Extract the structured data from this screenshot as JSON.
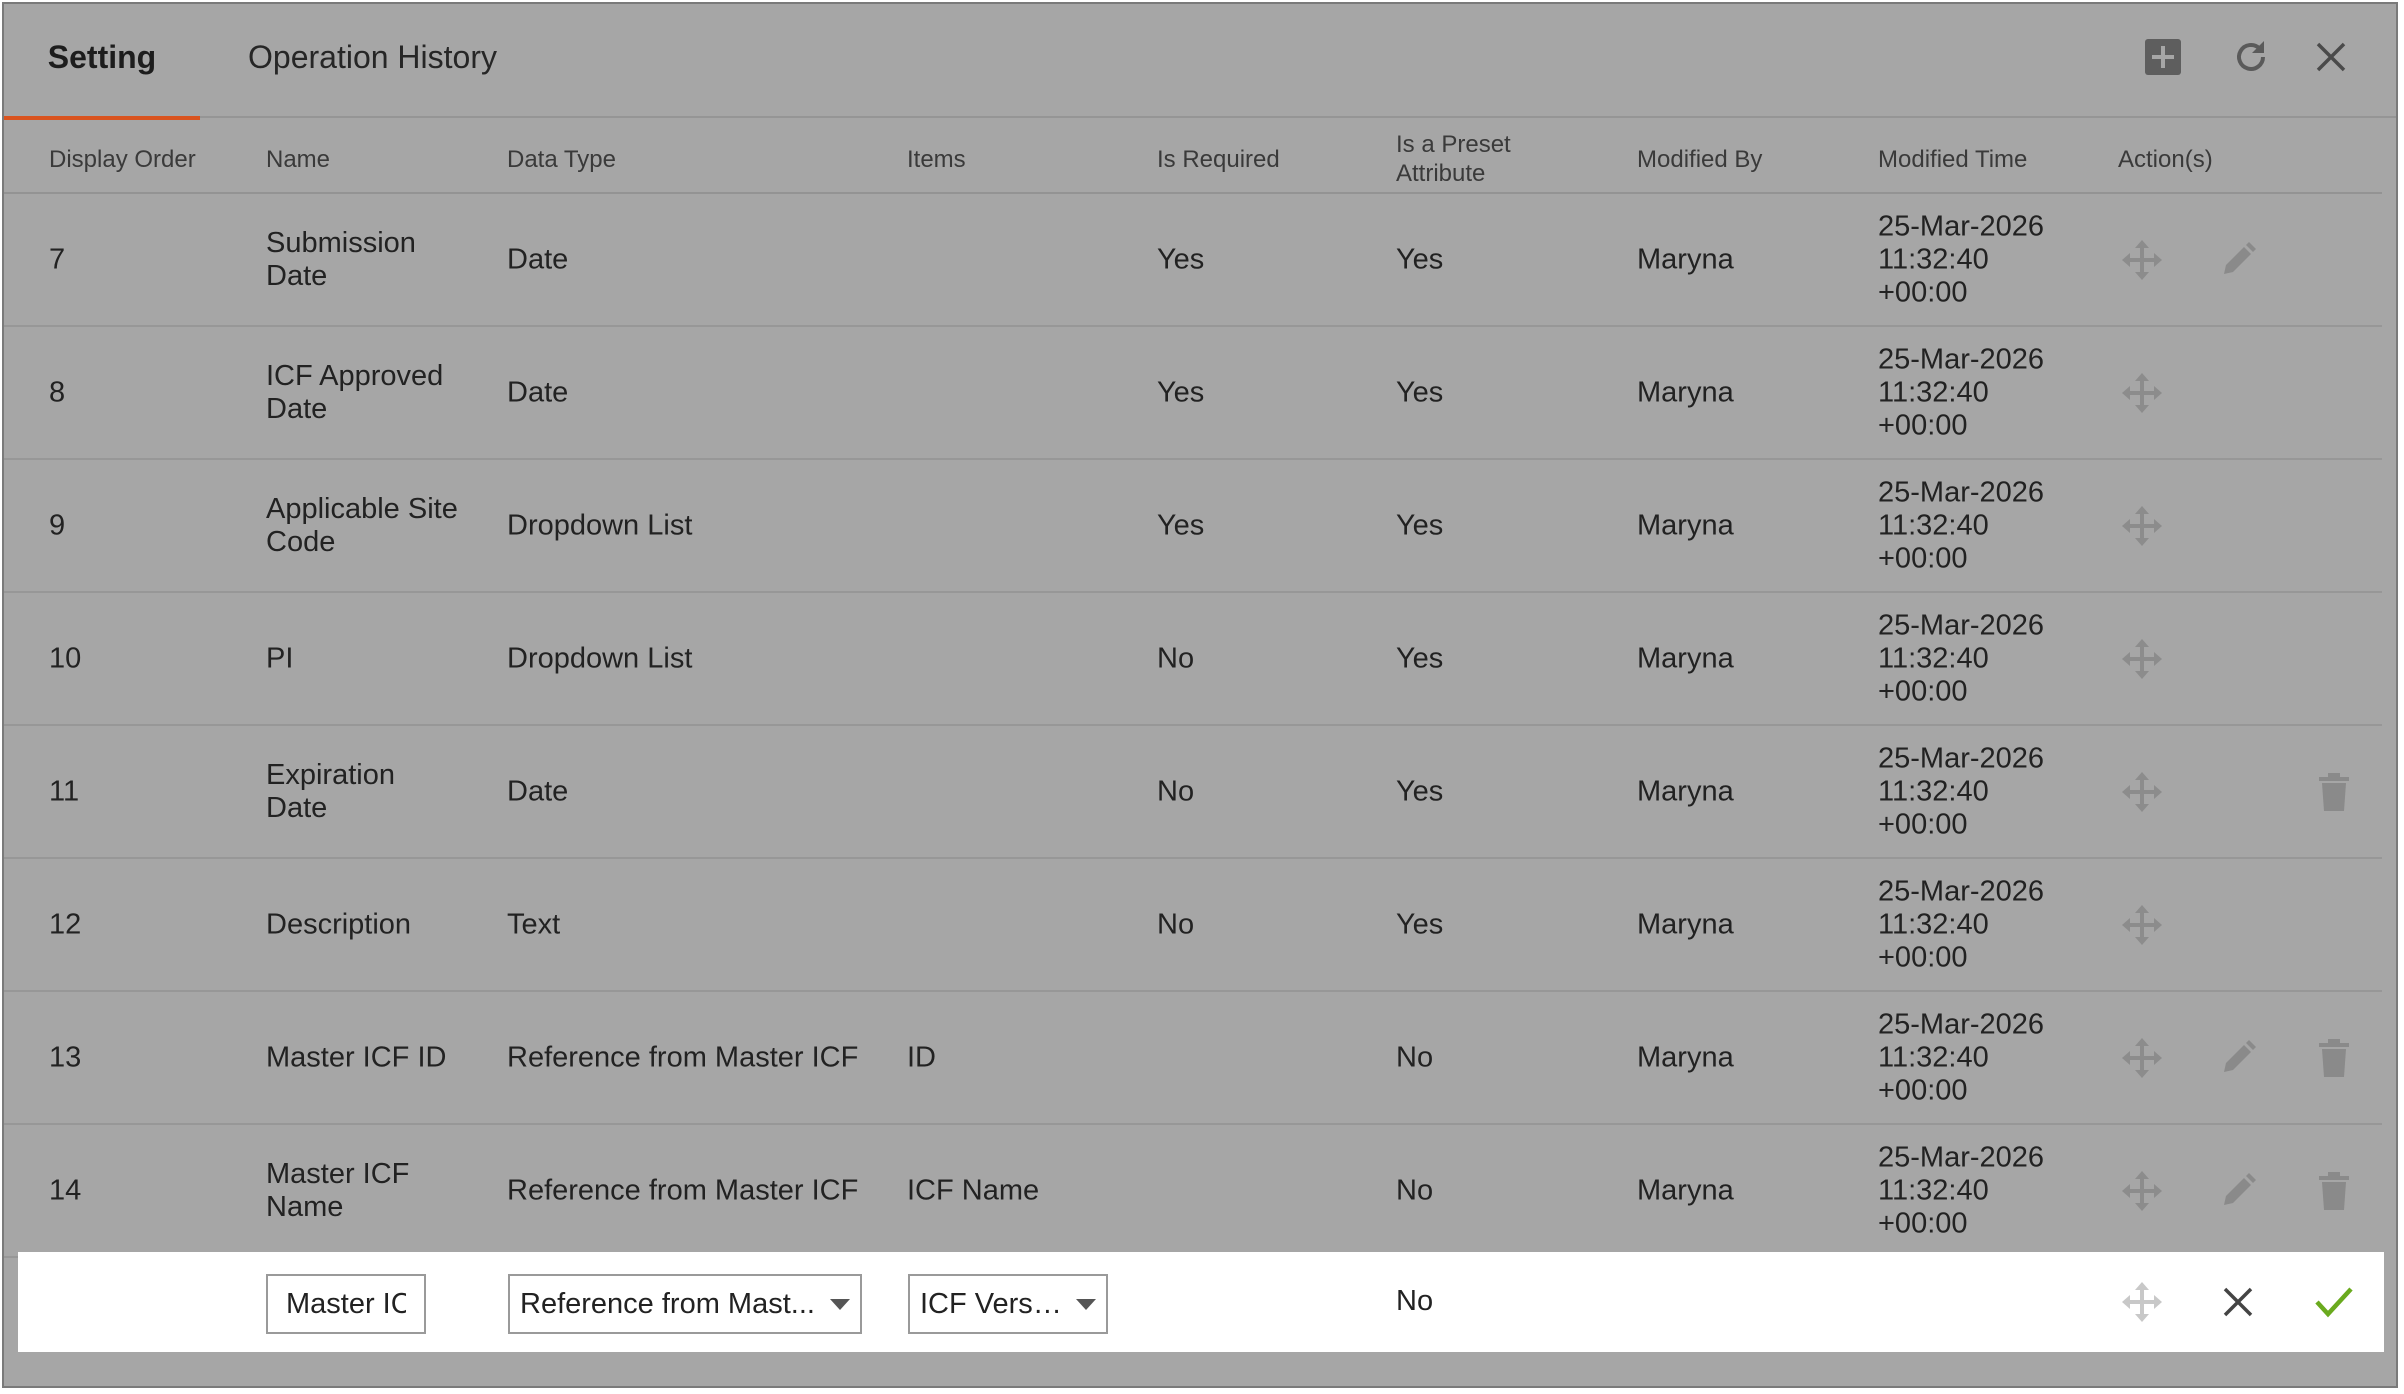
{
  "tabs": [
    {
      "label": "Setting",
      "active": true
    },
    {
      "label": "Operation History",
      "active": false
    }
  ],
  "header_icons": [
    "add-icon",
    "refresh-icon",
    "close-icon"
  ],
  "accent_color": "#d9531e",
  "columns": {
    "display_order": "Display Order",
    "name": "Name",
    "data_type": "Data Type",
    "items": "Items",
    "is_required": "Is Required",
    "is_preset_line1": "Is a Preset",
    "is_preset_line2": "Attribute",
    "modified_by": "Modified By",
    "modified_time": "Modified Time",
    "actions": "Action(s)"
  },
  "rows": [
    {
      "order": "7",
      "name1": "Submission",
      "name2": "Date",
      "data_type": "Date",
      "items": "",
      "required": "Yes",
      "preset": "Yes",
      "modified_by": "Maryna",
      "time1": "25-Mar-2026",
      "time2": "11:32:40",
      "time3": "+00:00",
      "actions": [
        "move",
        "edit"
      ]
    },
    {
      "order": "8",
      "name1": "ICF Approved",
      "name2": "Date",
      "data_type": "Date",
      "items": "",
      "required": "Yes",
      "preset": "Yes",
      "modified_by": "Maryna",
      "time1": "25-Mar-2026",
      "time2": "11:32:40",
      "time3": "+00:00",
      "actions": [
        "move"
      ]
    },
    {
      "order": "9",
      "name1": "Applicable Site",
      "name2": "Code",
      "data_type": "Dropdown List",
      "items": "",
      "required": "Yes",
      "preset": "Yes",
      "modified_by": "Maryna",
      "time1": "25-Mar-2026",
      "time2": "11:32:40",
      "time3": "+00:00",
      "actions": [
        "move"
      ]
    },
    {
      "order": "10",
      "name1": "PI",
      "name2": "",
      "data_type": "Dropdown List",
      "items": "",
      "required": "No",
      "preset": "Yes",
      "modified_by": "Maryna",
      "time1": "25-Mar-2026",
      "time2": "11:32:40",
      "time3": "+00:00",
      "actions": [
        "move"
      ]
    },
    {
      "order": "11",
      "name1": "Expiration",
      "name2": "Date",
      "data_type": "Date",
      "items": "",
      "required": "No",
      "preset": "Yes",
      "modified_by": "Maryna",
      "time1": "25-Mar-2026",
      "time2": "11:32:40",
      "time3": "+00:00",
      "actions": [
        "move",
        "delete"
      ]
    },
    {
      "order": "12",
      "name1": "Description",
      "name2": "",
      "data_type": "Text",
      "items": "",
      "required": "No",
      "preset": "Yes",
      "modified_by": "Maryna",
      "time1": "25-Mar-2026",
      "time2": "11:32:40",
      "time3": "+00:00",
      "actions": [
        "move"
      ]
    },
    {
      "order": "13",
      "name1": "Master ICF ID",
      "name2": "",
      "data_type": "Reference from Master ICF",
      "items": "ID",
      "required": "",
      "preset": "No",
      "modified_by": "Maryna",
      "time1": "25-Mar-2026",
      "time2": "11:32:40",
      "time3": "+00:00",
      "actions": [
        "move",
        "edit",
        "delete"
      ]
    },
    {
      "order": "14",
      "name1": "Master ICF",
      "name2": "Name",
      "data_type": "Reference from Master ICF",
      "items": "ICF Name",
      "required": "",
      "preset": "No",
      "modified_by": "Maryna",
      "time1": "25-Mar-2026",
      "time2": "11:32:40",
      "time3": "+00:00",
      "actions": [
        "move",
        "edit",
        "delete"
      ]
    }
  ],
  "edit_row": {
    "name_value": "Master IC",
    "data_type_value": "Reference from Mast...",
    "items_value": "ICF Version",
    "preset": "No",
    "confirm_color": "#6aaa1e"
  }
}
